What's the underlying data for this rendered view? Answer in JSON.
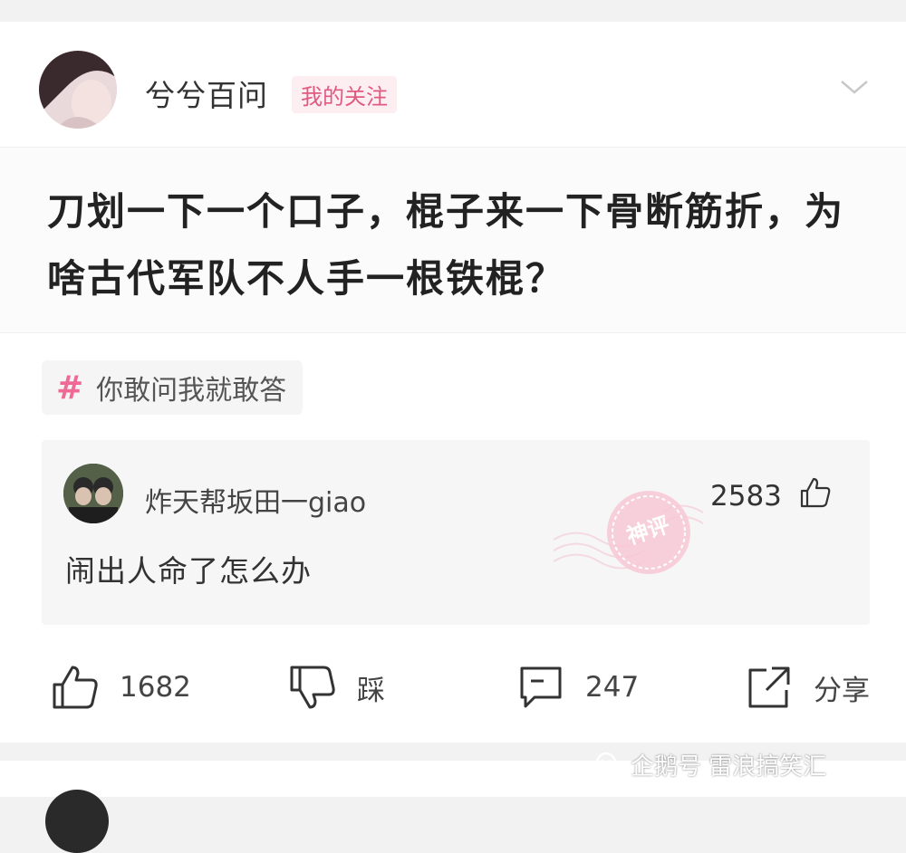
{
  "post": {
    "username": "兮兮百问",
    "follow_badge": "我的关注",
    "title": "刀划一下一个口子，棍子来一下骨断筋折，为啥古代军队不人手一根铁棍？",
    "topic": "你敢问我就敢答"
  },
  "comment": {
    "username": "炸天帮坂田一giao",
    "likes": "2583",
    "text": "闹出人命了怎么办",
    "stamp_label": "神评"
  },
  "actions": {
    "like_count": "1682",
    "dislike_label": "踩",
    "comment_count": "247",
    "share_label": "分享"
  },
  "watermark": {
    "text": "企鹅号 雷浪搞笑汇"
  },
  "colors": {
    "accent_pink": "#f06a96",
    "badge_text": "#e05a80",
    "badge_bg": "#fdeef2"
  }
}
